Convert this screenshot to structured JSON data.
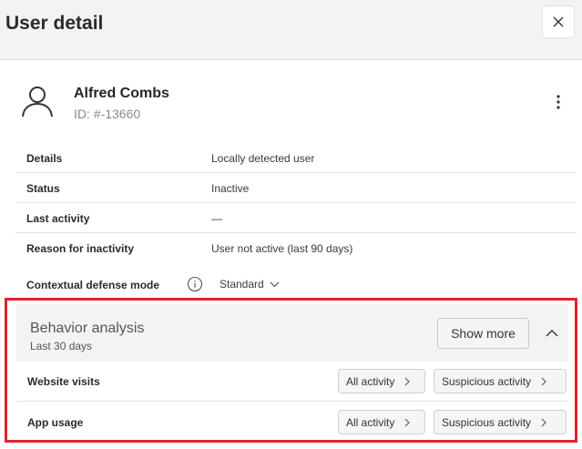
{
  "header": {
    "title": "User detail"
  },
  "user": {
    "name": "Alfred Combs",
    "id": "ID: #-13660"
  },
  "details": [
    {
      "label": "Details",
      "value": "Locally detected user"
    },
    {
      "label": "Status",
      "value": "Inactive"
    },
    {
      "label": "Last activity",
      "value": "—"
    },
    {
      "label": "Reason for inactivity",
      "value": "User not active (last 90 days)"
    }
  ],
  "contextual": {
    "label": "Contextual defense mode",
    "value": "Standard"
  },
  "behavior": {
    "title": "Behavior analysis",
    "subtitle": "Last 30 days",
    "show_more": "Show more",
    "rows": [
      {
        "label": "Website visits",
        "all": "All activity",
        "suspicious": "Suspicious activity"
      },
      {
        "label": "App usage",
        "all": "All activity",
        "suspicious": "Suspicious activity"
      }
    ]
  },
  "colors": {
    "highlight_border": "#e0242f",
    "header_bg": "#f3f3f3"
  }
}
